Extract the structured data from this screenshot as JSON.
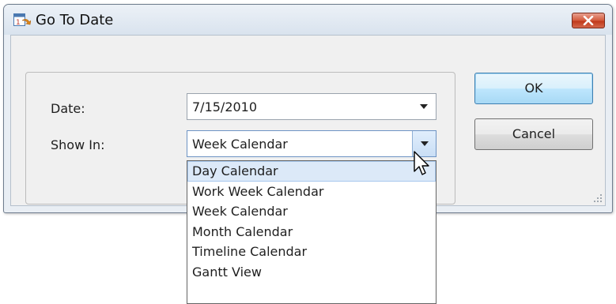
{
  "window": {
    "title": "Go To Date"
  },
  "form": {
    "date_label": "Date:",
    "date_value": "7/15/2010",
    "show_in_label": "Show In:",
    "show_in_value": "Week Calendar"
  },
  "buttons": {
    "ok": "OK",
    "cancel": "Cancel"
  },
  "dropdown": {
    "options": [
      "Day Calendar",
      "Work Week Calendar",
      "Week Calendar",
      "Month Calendar",
      "Timeline Calendar",
      "Gantt View"
    ],
    "highlighted": "Day Calendar"
  },
  "colors": {
    "close_button": "#c0391b",
    "highlight": "#dce9f8",
    "default_button_border": "#3c7fb1"
  },
  "icons": {
    "title": "calendar-goto-icon",
    "close": "close-icon",
    "dropdown_arrow": "chevron-down-icon",
    "cursor": "mouse-pointer-icon",
    "grip": "resize-grip-icon"
  }
}
